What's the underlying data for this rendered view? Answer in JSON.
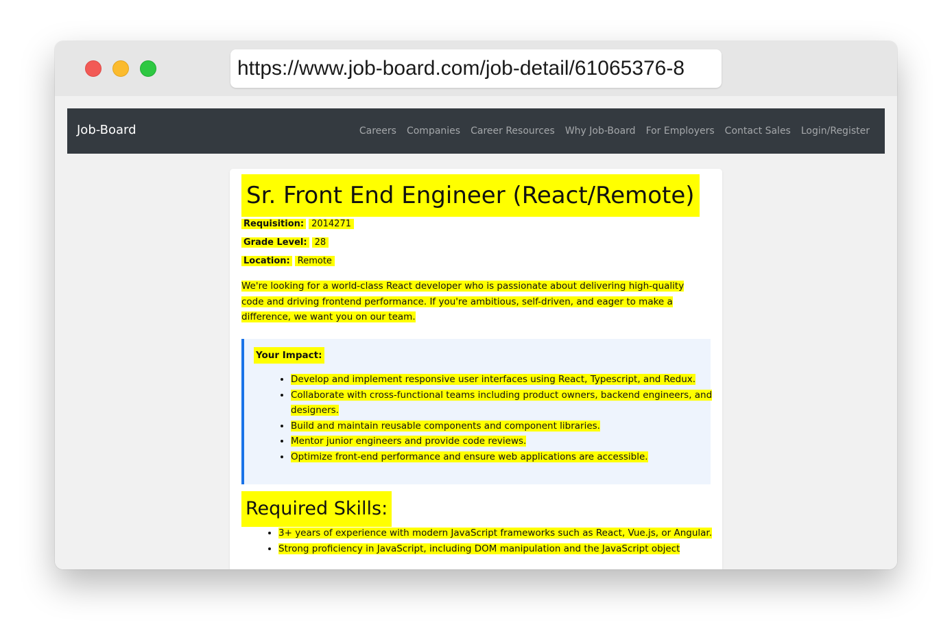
{
  "browser": {
    "url": "https://www.job-board.com/job-detail/61065376-8"
  },
  "navbar": {
    "brand": "Job-Board",
    "links": [
      "Careers",
      "Companies",
      "Career Resources",
      "Why Job-Board",
      "For Employers",
      "Contact Sales",
      "Login/Register"
    ]
  },
  "job": {
    "title": "Sr. Front End Engineer (React/Remote)",
    "requisition_label": "Requisition:",
    "requisition_value": "2014271",
    "grade_label": "Grade Level:",
    "grade_value": "28",
    "location_label": "Location:",
    "location_value": "Remote",
    "intro": "We're looking for a world-class React developer who is passionate about delivering high-quality code and driving frontend performance. If you're ambitious, self-driven, and eager to make a difference, we want you on our team.",
    "impact_heading": "Your Impact:",
    "impact_items": [
      "Develop and implement responsive user interfaces using React, Typescript, and Redux.",
      "Collaborate with cross-functional teams including product owners, backend engineers, and designers.",
      "Build and maintain reusable components and component libraries.",
      "Mentor junior engineers and provide code reviews.",
      "Optimize front-end performance and ensure web applications are accessible."
    ],
    "skills_heading": "Required Skills:",
    "skills_items": [
      "3+ years of experience with modern JavaScript frameworks such as React, Vue.js, or Angular.",
      "Strong proficiency in JavaScript, including DOM manipulation and the JavaScript object"
    ]
  },
  "colors": {
    "highlight": "#ffff00",
    "navbar": "#343a40",
    "accent": "#1a73e8"
  }
}
